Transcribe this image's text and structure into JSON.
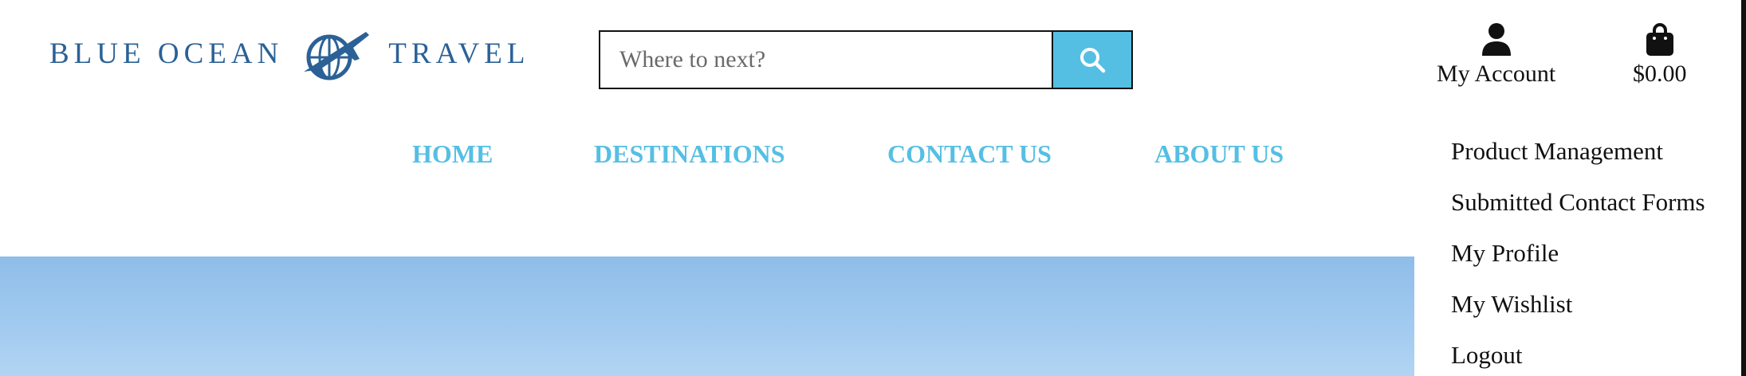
{
  "brand": {
    "word1": "BLUE OCEAN",
    "word2": "TRAVEL",
    "color": "#2b6196",
    "icon": "globe-plane-icon"
  },
  "search": {
    "placeholder": "Where to next?",
    "value": "",
    "button_icon": "search-icon",
    "accent": "#55bfe3"
  },
  "header": {
    "account": {
      "label": "My Account",
      "icon": "user-icon"
    },
    "bag": {
      "total": "$0.00",
      "icon": "shopping-bag-icon"
    }
  },
  "nav": {
    "items": [
      "HOME",
      "DESTINATIONS",
      "CONTACT US",
      "ABOUT US"
    ],
    "color": "#55bfe3"
  },
  "account_menu": {
    "items": [
      "Product Management",
      "Submitted Contact Forms",
      "My Profile",
      "My Wishlist",
      "Logout"
    ]
  }
}
